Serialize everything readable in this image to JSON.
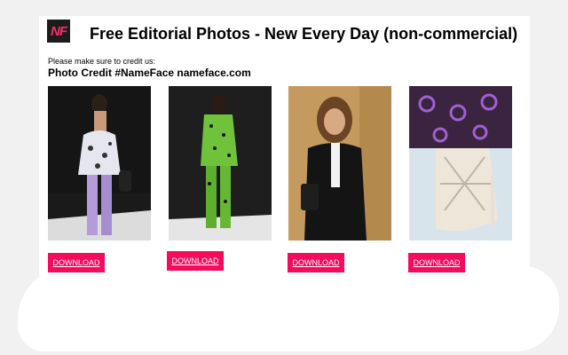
{
  "header": {
    "logo_text": "NF",
    "title": "Free Editorial Photos - New Every Day (non-commercial)"
  },
  "credit": {
    "note": "Please make sure to credit us:",
    "line": "Photo Credit #NameFace nameface.com"
  },
  "photos": [
    {
      "subject": "model on runway in leopard print top and purple leggings",
      "download_label": "DOWNLOAD"
    },
    {
      "subject": "model on runway in green leopard print suit",
      "download_label": "DOWNLOAD"
    },
    {
      "subject": "woman in black outfit at event",
      "download_label": "DOWNLOAD"
    },
    {
      "subject": "close-up of white strappy heel and purple patterned fabric",
      "download_label": "DOWNLOAD"
    }
  ],
  "colors": {
    "accent": "#f50a5c",
    "logo_bg": "#1c1c1c",
    "logo_text": "#ff2a6a"
  }
}
